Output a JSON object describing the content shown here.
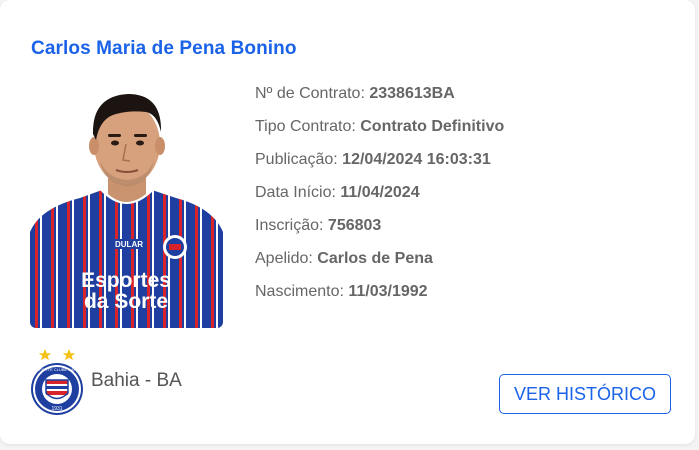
{
  "player": {
    "name": "Carlos Maria de Pena Bonino",
    "fields": [
      {
        "label": "Nº de Contrato:",
        "value": "2338613BA"
      },
      {
        "label": "Tipo Contrato:",
        "value": "Contrato Definitivo"
      },
      {
        "label": "Publicação:",
        "value": "12/04/2024 16:03:31"
      },
      {
        "label": "Data Início:",
        "value": "11/04/2024"
      },
      {
        "label": "Inscrição:",
        "value": "756803"
      },
      {
        "label": "Apelido:",
        "value": "Carlos de Pena"
      },
      {
        "label": "Nascimento:",
        "value": "11/03/1992"
      }
    ],
    "shirt_sponsor_line1": "Esportes",
    "shirt_sponsor_line2": "da Sorte",
    "shirt_brand": "DULAR"
  },
  "club": {
    "name": "Bahia - BA",
    "logo_text": "ESPORTE CLUBE BAHIA",
    "logo_year": "1931"
  },
  "actions": {
    "history_button": "VER HISTÓRICO"
  },
  "colors": {
    "accent": "#1a62e8",
    "text": "#666666",
    "shirt_blue": "#1f3fa0",
    "shirt_red": "#d8232a"
  }
}
